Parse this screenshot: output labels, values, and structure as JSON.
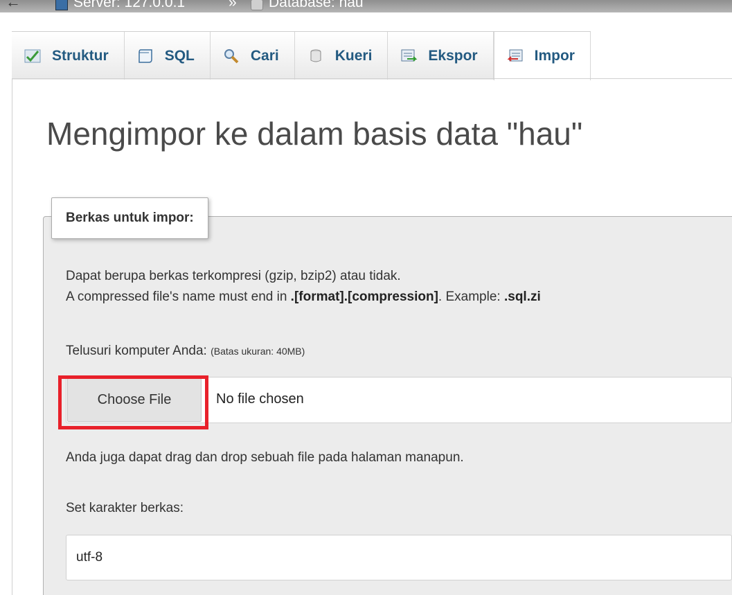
{
  "breadcrumb": {
    "back": "←",
    "server": "Server: 127.0.0.1",
    "separator": "»",
    "database": "Database: hau"
  },
  "tabs": [
    {
      "label": "Struktur",
      "icon": "structure-icon"
    },
    {
      "label": "SQL",
      "icon": "sql-icon"
    },
    {
      "label": "Cari",
      "icon": "search-icon"
    },
    {
      "label": "Kueri",
      "icon": "query-icon"
    },
    {
      "label": "Ekspor",
      "icon": "export-icon"
    },
    {
      "label": "Impor",
      "icon": "import-icon",
      "active": true
    }
  ],
  "main": {
    "title": "Mengimpor ke dalam basis data \"hau\"",
    "fieldset": {
      "legend": "Berkas untuk impor:",
      "line1": "Dapat berupa berkas terkompresi (gzip, bzip2) atau tidak.",
      "line2_pre": "A compressed file's name must end in ",
      "line2_bold1": ".[format].[compression]",
      "line2_mid": ". Example: ",
      "line2_bold2": ".sql.zi",
      "browse_label": "Telusuri komputer Anda: ",
      "size_limit": "(Batas ukuran: 40MB)",
      "choose_file": "Choose File",
      "no_file": "No file chosen",
      "drag_hint": "Anda juga dapat drag dan drop sebuah file pada halaman manapun.",
      "charset_label": "Set karakter berkas:",
      "charset_value": "utf-8"
    }
  },
  "colors": {
    "tab_text": "#235a81",
    "highlight": "#e8202a"
  }
}
